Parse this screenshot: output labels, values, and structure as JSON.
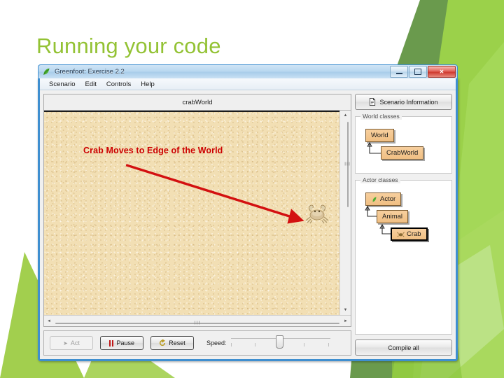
{
  "slide": {
    "title": "Running your code",
    "title_color": "#93c234",
    "background": "#ffffff"
  },
  "decor": {
    "green_dark": "#6a9a4d",
    "green_mid": "#8cc63f",
    "green_light": "#a6d95b",
    "green_pale": "#bfe08a"
  },
  "window": {
    "title": "Greenfoot: Exercise 2.2",
    "app_icon": "greenfoot-icon",
    "controls": {
      "minimize": "minimize-icon",
      "maximize": "maximize-icon",
      "close": "close-icon",
      "close_glyph": "✕"
    },
    "menu": [
      {
        "label": "Scenario"
      },
      {
        "label": "Edit"
      },
      {
        "label": "Controls"
      },
      {
        "label": "Help"
      }
    ]
  },
  "world": {
    "header_label": "crabWorld",
    "annotation": "Crab Moves to Edge of the World",
    "annotation_color": "#cc0000",
    "sand_color": "#f2dfb4",
    "sprite": "crab-sprite",
    "vscroll_up": "▲",
    "vscroll_down": "▼",
    "hscroll_left": "◄",
    "hscroll_right": "►",
    "grip": "III"
  },
  "controls": {
    "act": "Act",
    "pause": "Pause",
    "reset": "Reset",
    "speed_label": "Speed:",
    "act_icon": "play-arrow-icon",
    "pause_icon": "pause-bars-icon",
    "reset_icon": "refresh-icon",
    "act_glyph": "➤",
    "speed_value": 45
  },
  "sidebar": {
    "scenario_info": "Scenario Information",
    "scenario_info_icon": "document-icon",
    "world_classes_legend": "World classes",
    "actor_classes_legend": "Actor classes",
    "world_classes": [
      {
        "label": "World",
        "icon": "",
        "selected": false
      },
      {
        "label": "CrabWorld",
        "icon": "",
        "selected": false
      }
    ],
    "actor_classes": [
      {
        "label": "Actor",
        "icon": "actor-icon",
        "selected": false
      },
      {
        "label": "Animal",
        "icon": "",
        "selected": false
      },
      {
        "label": "Crab",
        "icon": "crab-icon",
        "selected": true
      }
    ],
    "compile_all": "Compile all"
  }
}
